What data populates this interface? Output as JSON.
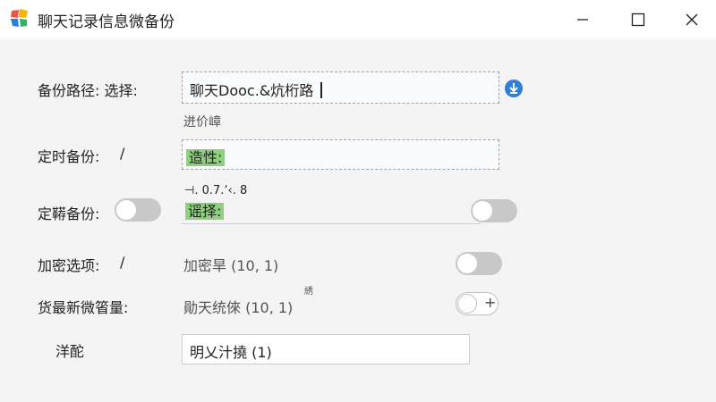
{
  "window": {
    "title": "聊天记录信息微备份",
    "icon": "app-icon",
    "controls": {
      "minimize": "minimize-icon",
      "maximize": "maximize-icon",
      "close": "close-icon"
    }
  },
  "rows": {
    "backup_path": {
      "label": "备份路径: 选择:",
      "value": "聊天Dooc.&炕桁路",
      "hint": "迸价嶂"
    },
    "scheduled_backup": {
      "label": "定时备份:",
      "slash": "/",
      "value": "造性:"
    },
    "scheduled_backup_2": {
      "label": "定鞯备份:",
      "caption": "⊣. 0.7.ʼ‹. 8",
      "value": "谣择:",
      "toggle_on": false,
      "toggle2_on": false
    },
    "encryption": {
      "label": "加密选项:",
      "slash": "/",
      "value": "加密旱 (10, 1)",
      "toggle_on": false
    },
    "latest": {
      "label": "货最新微箵量:",
      "value": "勛天统倈 (10, 1)",
      "superscript": "綉",
      "plus": "+"
    },
    "footer": {
      "label": "洋酡",
      "value": "明乂汁撓 (1)"
    }
  },
  "colors": {
    "highlight": "#8ed07f",
    "accent": "#2f7fd6"
  }
}
